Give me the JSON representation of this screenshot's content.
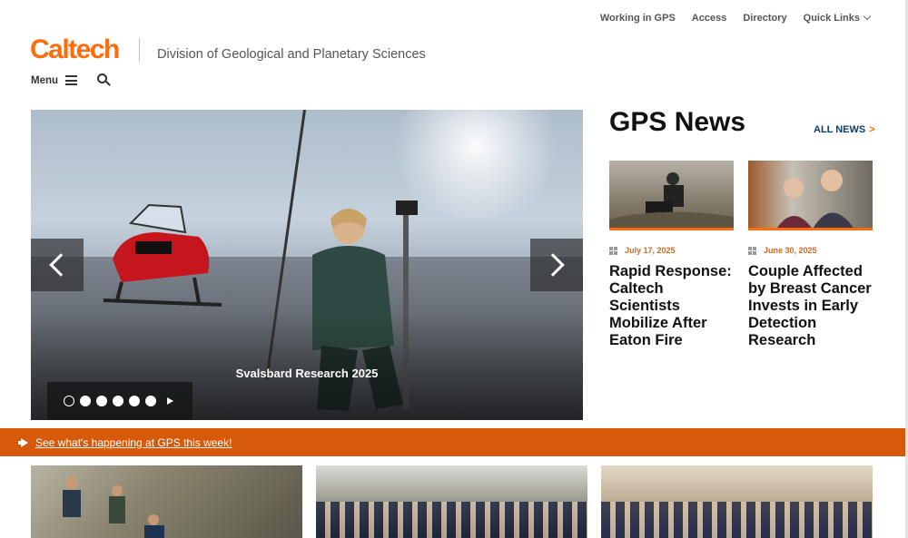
{
  "utility_nav": {
    "working_in_gps": "Working in GPS",
    "access": "Access",
    "directory": "Directory",
    "quick_links": "Quick Links"
  },
  "header": {
    "logo": "Caltech",
    "division": "Division of Geological and Planetary Sciences",
    "menu_label": "Menu"
  },
  "hero": {
    "caption": "Svalsbard Research 2025",
    "slide_count": 6,
    "active_slide": 1
  },
  "news": {
    "title": "GPS News",
    "all_news_label": "ALL NEWS",
    "all_news_arrow": ">",
    "items": [
      {
        "date": "July 17, 2025",
        "headline": "Rapid Response: Caltech Scientists Mobilize After Eaton Fire"
      },
      {
        "date": "June 30, 2025",
        "headline": "Couple Affected by Breast Cancer Invests in Early Detection Research"
      }
    ]
  },
  "announcement": {
    "link_text": "See what's happening at GPS this week!"
  },
  "colors": {
    "brand_orange": "#ff6c0c",
    "banner_orange": "#d65a0a",
    "link_navy": "#0b3d6b"
  }
}
